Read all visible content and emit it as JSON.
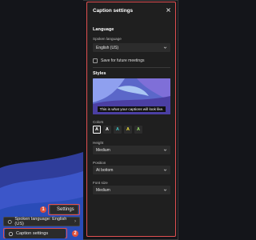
{
  "left": {
    "settings_label": "Settings",
    "spoken_language_label": "Spoken language: English (US)",
    "caption_settings_label": "Caption settings",
    "markers": [
      "1",
      "2"
    ]
  },
  "panel": {
    "title": "Caption settings",
    "language_section": "Language",
    "spoken_language_label": "Spoken language",
    "spoken_language_value": "English (US)",
    "save_future_label": "Save for future meetings",
    "styles_section": "Styles",
    "preview_caption": "This is what your captions will look like.",
    "colors_label": "Colors",
    "colors": [
      {
        "letter": "A",
        "color": "#ffffff",
        "selected": true
      },
      {
        "letter": "A",
        "color": "#ffffff",
        "selected": false
      },
      {
        "letter": "A",
        "color": "#3ec7c7",
        "selected": false
      },
      {
        "letter": "A",
        "color": "#f2e23a",
        "selected": false
      },
      {
        "letter": "A",
        "color": "#9be26a",
        "selected": false
      }
    ],
    "height_label": "Height",
    "height_value": "Medium",
    "position_label": "Position",
    "position_value": "At bottom",
    "font_size_label": "Font size",
    "font_size_value": "Medium"
  },
  "accent": "#e05050"
}
